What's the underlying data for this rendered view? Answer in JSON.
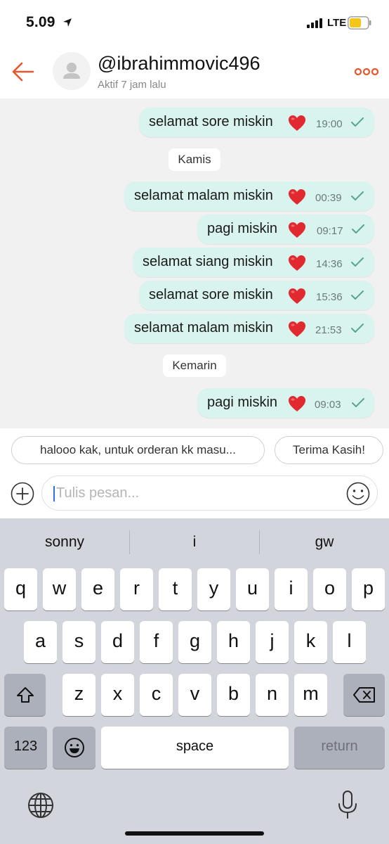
{
  "status_bar": {
    "time": "5.09",
    "network": "LTE"
  },
  "header": {
    "username": "@ibrahimmovic496",
    "last_seen": "Aktif 7 jam lalu",
    "accent_color": "#e5572f"
  },
  "messages": [
    {
      "text": "selamat sore miskin",
      "time": "19:00"
    },
    {
      "date_separator": "Kamis"
    },
    {
      "text": "selamat malam miskin",
      "time": "00:39"
    },
    {
      "text": "pagi miskin",
      "time": "09:17"
    },
    {
      "text": "selamat siang miskin",
      "time": "14:36"
    },
    {
      "text": "selamat sore miskin",
      "time": "15:36"
    },
    {
      "text": "selamat malam miskin",
      "time": "21:53"
    },
    {
      "date_separator": "Kemarin"
    },
    {
      "text": "pagi miskin",
      "time": "09:03"
    }
  ],
  "quick_replies": [
    "halooo kak, untuk orderan kk masu...",
    "Terima Kasih!"
  ],
  "composer": {
    "placeholder": "Tulis pesan..."
  },
  "keyboard": {
    "suggestions": [
      "sonny",
      "i",
      "gw"
    ],
    "row1": [
      "q",
      "w",
      "e",
      "r",
      "t",
      "y",
      "u",
      "i",
      "o",
      "p"
    ],
    "row2": [
      "a",
      "s",
      "d",
      "f",
      "g",
      "h",
      "j",
      "k",
      "l"
    ],
    "row3": [
      "z",
      "x",
      "c",
      "v",
      "b",
      "n",
      "m"
    ],
    "numbers_key": "123",
    "space_key": "space",
    "return_key": "return"
  },
  "icons": {
    "back": "arrow-left-icon",
    "more": "more-dots-icon",
    "heart": "red-heart-emoji",
    "read": "check-icon"
  }
}
